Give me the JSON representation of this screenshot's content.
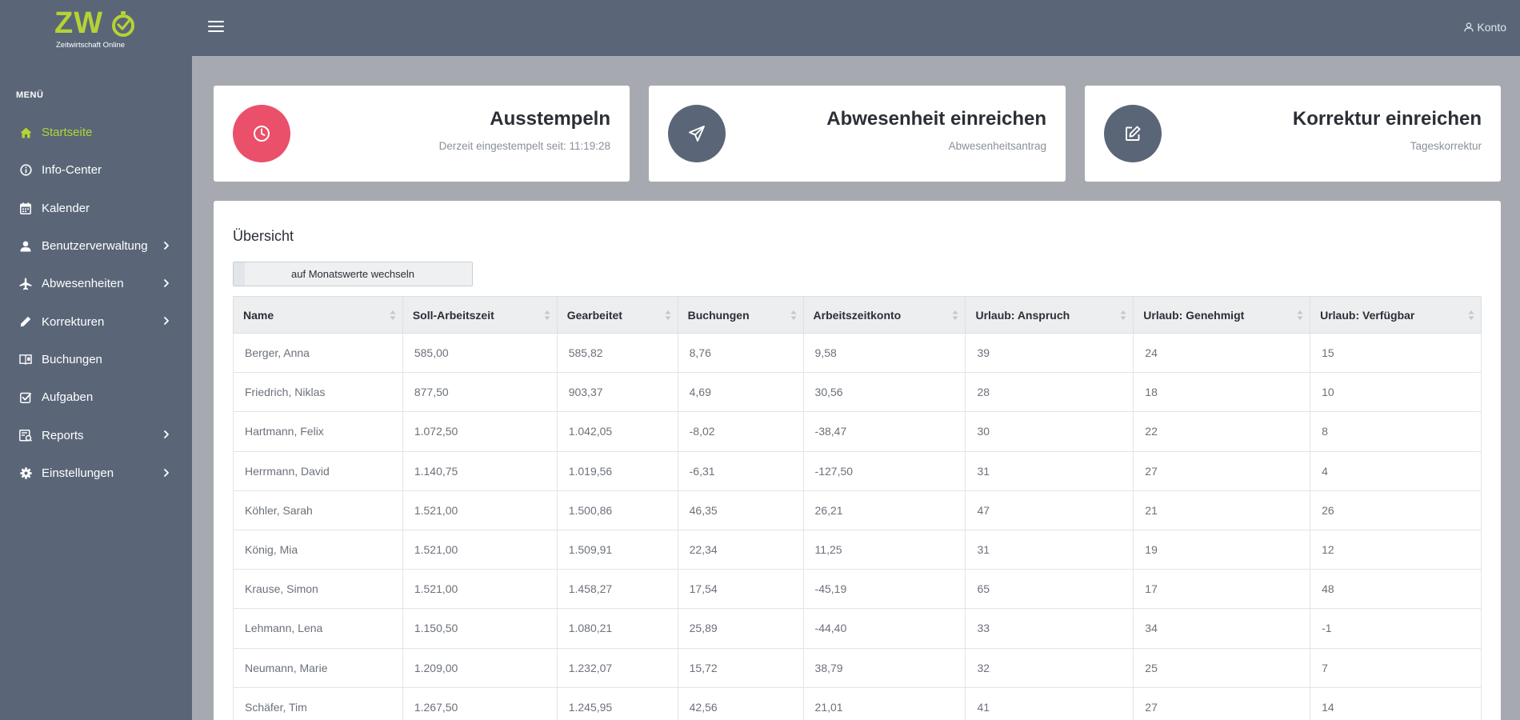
{
  "brand": {
    "letters": "ZW",
    "tagline": "Zeitwirtschaft Online",
    "color": "#b5d334"
  },
  "topbar": {
    "account_label": "Konto",
    "background": "#5a6678"
  },
  "sidebar": {
    "menu_label": "MENÜ",
    "items": [
      {
        "label": "Startseite",
        "icon": "home-icon",
        "active": true,
        "has_submenu": false
      },
      {
        "label": "Info-Center",
        "icon": "info-icon",
        "active": false,
        "has_submenu": false
      },
      {
        "label": "Kalender",
        "icon": "calendar-icon",
        "active": false,
        "has_submenu": false
      },
      {
        "label": "Benutzerverwaltung",
        "icon": "user-icon",
        "active": false,
        "has_submenu": true
      },
      {
        "label": "Abwesenheiten",
        "icon": "airplane-icon",
        "active": false,
        "has_submenu": true
      },
      {
        "label": "Korrekturen",
        "icon": "pencil-icon",
        "active": false,
        "has_submenu": true
      },
      {
        "label": "Buchungen",
        "icon": "book-icon",
        "active": false,
        "has_submenu": false
      },
      {
        "label": "Aufgaben",
        "icon": "checkbox-icon",
        "active": false,
        "has_submenu": false
      },
      {
        "label": "Reports",
        "icon": "report-icon",
        "active": false,
        "has_submenu": true
      },
      {
        "label": "Einstellungen",
        "icon": "gear-icon",
        "active": false,
        "has_submenu": true
      }
    ]
  },
  "cards": [
    {
      "title": "Ausstempeln",
      "subtitle": "Derzeit eingestempelt seit: 11:19:28",
      "icon": "clock-icon",
      "color": "#ea5069"
    },
    {
      "title": "Abwesenheit einreichen",
      "subtitle": "Abwesenheitsantrag",
      "icon": "send-icon",
      "color": "#5a6678"
    },
    {
      "title": "Korrektur einreichen",
      "subtitle": "Tageskorrektur",
      "icon": "edit-icon",
      "color": "#5a6678"
    }
  ],
  "overview": {
    "title": "Übersicht",
    "toggle_label": "auf Monatswerte wechseln",
    "columns": [
      "Name",
      "Soll-Arbeitszeit",
      "Gearbeitet",
      "Buchungen",
      "Arbeitszeitkonto",
      "Urlaub: Anspruch",
      "Urlaub: Genehmigt",
      "Urlaub: Verfügbar"
    ],
    "rows": [
      [
        "Berger, Anna",
        "585,00",
        "585,82",
        "8,76",
        "9,58",
        "39",
        "24",
        "15"
      ],
      [
        "Friedrich, Niklas",
        "877,50",
        "903,37",
        "4,69",
        "30,56",
        "28",
        "18",
        "10"
      ],
      [
        "Hartmann, Felix",
        "1.072,50",
        "1.042,05",
        "-8,02",
        "-38,47",
        "30",
        "22",
        "8"
      ],
      [
        "Herrmann, David",
        "1.140,75",
        "1.019,56",
        "-6,31",
        "-127,50",
        "31",
        "27",
        "4"
      ],
      [
        "Köhler, Sarah",
        "1.521,00",
        "1.500,86",
        "46,35",
        "26,21",
        "47",
        "21",
        "26"
      ],
      [
        "König, Mia",
        "1.521,00",
        "1.509,91",
        "22,34",
        "11,25",
        "31",
        "19",
        "12"
      ],
      [
        "Krause, Simon",
        "1.521,00",
        "1.458,27",
        "17,54",
        "-45,19",
        "65",
        "17",
        "48"
      ],
      [
        "Lehmann, Lena",
        "1.150,50",
        "1.080,21",
        "25,89",
        "-44,40",
        "33",
        "34",
        "-1"
      ],
      [
        "Neumann, Marie",
        "1.209,00",
        "1.232,07",
        "15,72",
        "38,79",
        "32",
        "25",
        "7"
      ],
      [
        "Schäfer, Tim",
        "1.267,50",
        "1.245,95",
        "42,56",
        "21,01",
        "41",
        "27",
        "14"
      ]
    ]
  }
}
